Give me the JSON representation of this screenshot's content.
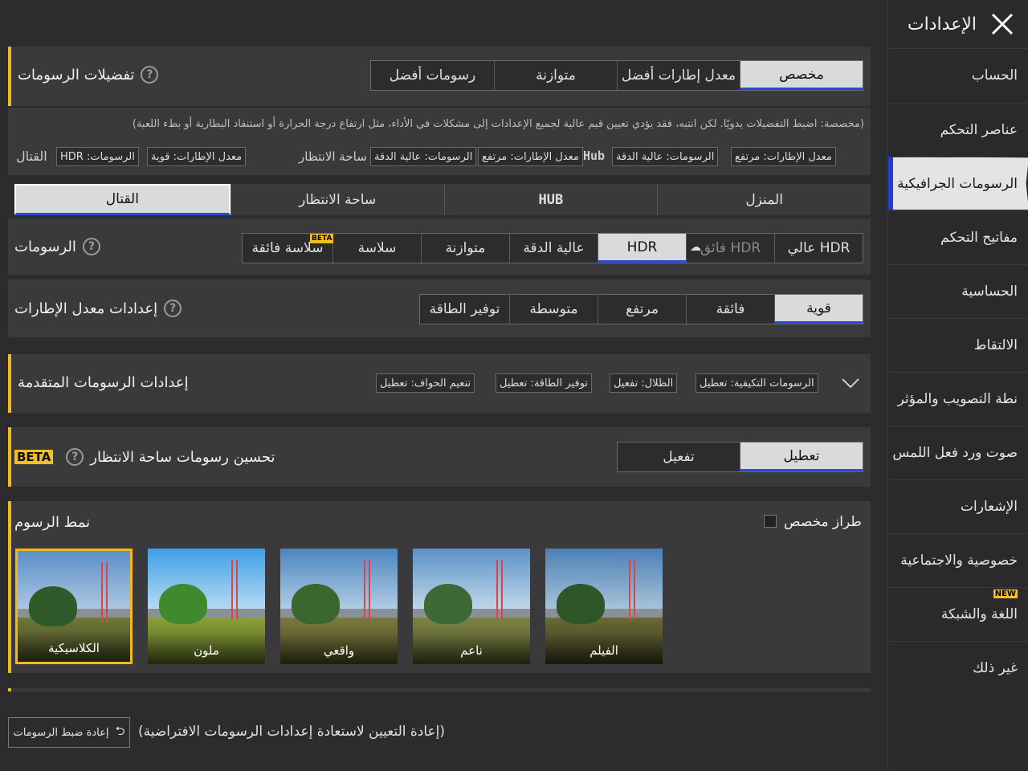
{
  "header": {
    "title": "الإعدادات"
  },
  "sidebar": {
    "items": [
      {
        "label": "الحساب"
      },
      {
        "label": "عناصر التحكم"
      },
      {
        "label": "الرسومات الجرافيكية",
        "active": true
      },
      {
        "label": "مفاتيح التحكم"
      },
      {
        "label": "الحساسية"
      },
      {
        "label": "الالتقاط"
      },
      {
        "label": "نطة التصويب والمؤثر"
      },
      {
        "label": "صوت ورد فعل اللمس"
      },
      {
        "label": "الإشعارات"
      },
      {
        "label": "خصوصية والاجتماعية"
      },
      {
        "label": "اللغة والشبكة",
        "badge": "NEW"
      },
      {
        "label": "غير ذلك"
      }
    ]
  },
  "preferences": {
    "label": "تفضيلات الرسومات",
    "options": [
      "مخصص",
      "معدل إطارات أفضل",
      "متوازنة",
      "رسومات أفضل"
    ],
    "selected": 0,
    "description": "(مخصصة: اضبط التفضيلات يدويًا. لكن انتبه، فقد يؤدي تعيين قيم عالية لجميع الإعدادات إلى مشكلات في الأداء، مثل ارتفاع درجة الحرارة أو استنفاد البطارية أو بطء اللعبة)",
    "presets": {
      "hub_label": "Hub",
      "lobby_chips": [
        "معدل الإطارات: مرتفع",
        "الرسومات: عالية الدقة"
      ],
      "hub_chips": [
        "معدل الإطارات: مرتفع",
        "الرسومات: عالية الدقة"
      ],
      "waiting_label": "ساحة الانتظار",
      "combat_chips": [
        "معدل الإطارات: قوية",
        "الرسومات: HDR"
      ],
      "combat_label": "القتال"
    }
  },
  "scene_tabs": {
    "items": [
      "المنزل",
      "HUB",
      "ساحة الانتظار",
      "القتال"
    ],
    "selected": 3
  },
  "graphics": {
    "label": "الرسومات",
    "options": [
      "عالي HDR",
      "فائق HDR",
      "HDR",
      "عالية الدقة",
      "متوازنة",
      "سلاسة",
      "سلاسة فائقة"
    ],
    "selected": 2,
    "beta_badge": "BETA"
  },
  "frame_rate": {
    "label": "إعدادات معدل الإطارات",
    "options": [
      "قوية",
      "فائقة",
      "مرتفع",
      "متوسطة",
      "توفير الطاقة"
    ],
    "selected": 0
  },
  "advanced": {
    "label": "إعدادات الرسومات المتقدمة",
    "chips": [
      "الرسومات التكيفية: تعطيل",
      "الظلال: تفعيل",
      "توفير الطاقة: تعطيل",
      "تنعيم الحواف: تعطيل"
    ]
  },
  "waiting_area": {
    "label": "تحسين رسومات ساحة الانتظار",
    "beta": "BETA",
    "options": [
      "تعطيل",
      "تفعيل"
    ],
    "selected": 0
  },
  "style": {
    "label": "نمط الرسوم",
    "custom_label": "طراز مخصص",
    "items": [
      "الكلاسيكية",
      "ملون",
      "واقعي",
      "ناعم",
      "الفيلم"
    ],
    "selected": 0
  },
  "reset": {
    "button_label": "إعادة ضبط الرسومات",
    "note": "(إعادة التعيين لاستعادة إعدادات الرسومات الافتراضية)"
  },
  "colors": {
    "accent": "#f3b81a",
    "selection_underline": "#2b47d6",
    "selected_bg": "#d9dadc"
  }
}
